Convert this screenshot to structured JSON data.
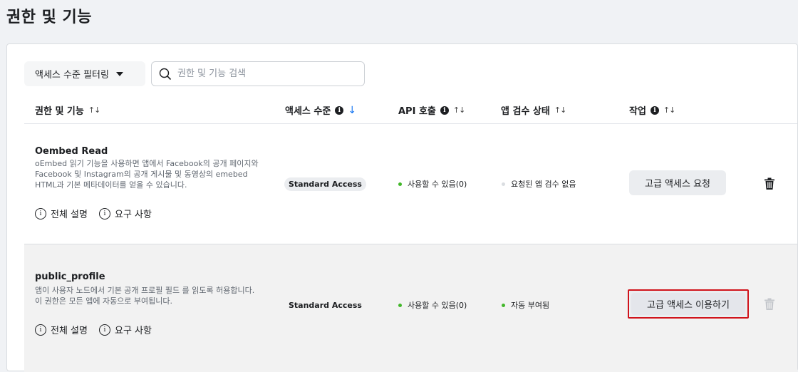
{
  "page_title": "권한 및 기능",
  "toolbar": {
    "filter_label": "액세스 수준 필터링",
    "search_placeholder": "권한 및 기능 검색"
  },
  "columns": {
    "permission": "권한 및 기능",
    "access_level": "액세스 수준",
    "api_calls": "API 호출",
    "app_review": "앱 검수 상태",
    "actions": "작업"
  },
  "rows": [
    {
      "name": "Oembed Read",
      "description": "oEmbed 읽기 기능을 사용하면 앱에서 Facebook의 공개 페이지와 Facebook 및 Instagram의 공개 게시물 및 동영상의 emebed HTML과 기본 메타데이터를 얻을 수 있습니다.",
      "link_overview": "전체 설명",
      "link_requirements": "요구 사항",
      "access_level": "Standard Access",
      "api_status": "사용할 수 있음(0)",
      "review_status": "요청된 앱 검수 없음",
      "action_label": "고급 액세스 요청"
    },
    {
      "name": "public_profile",
      "description": "앱이 사용자 노드에서 기본 공개 프로필 필드 를 읽도록 허용합니다. 이 권한은 모든 앱에 자동으로 부여됩니다.",
      "link_overview": "전체 설명",
      "link_requirements": "요구 사항",
      "access_level": "Standard Access",
      "api_status": "사용할 수 있음(0)",
      "review_status": "자동 부여됨",
      "action_label": "고급 액세스 이용하기"
    }
  ],
  "colors": {
    "status_green": "#42b72a",
    "status_gray": "#dadde1",
    "sort_active": "#1877f2",
    "highlight_border": "#d0131b"
  }
}
